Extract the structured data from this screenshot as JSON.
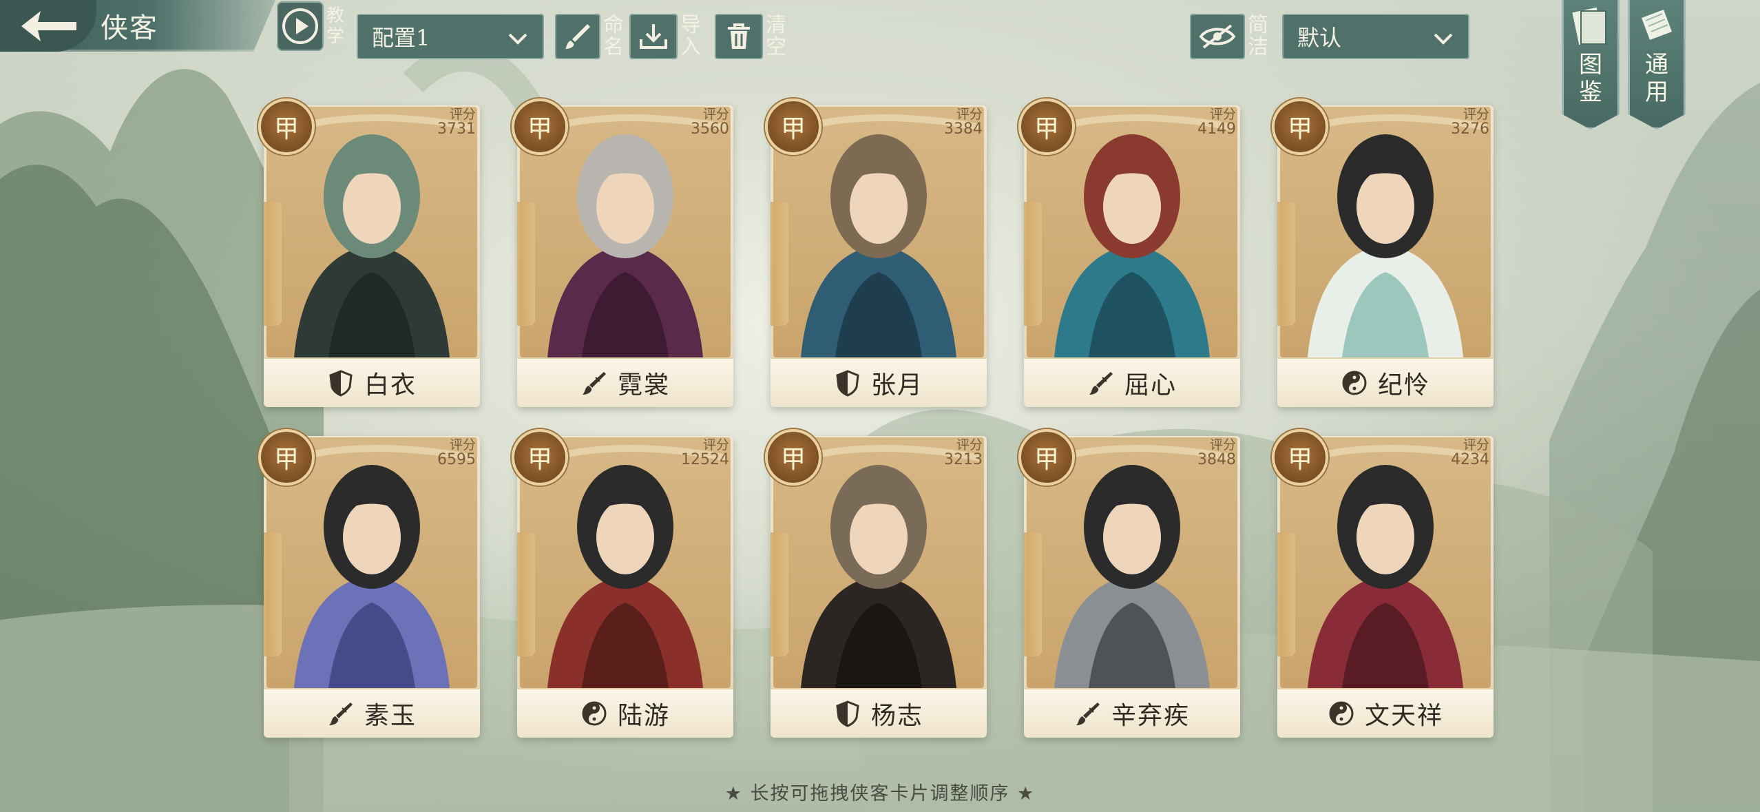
{
  "header": {
    "title": "侠客",
    "tutorial_label": "教学",
    "config_select": {
      "value": "配置1"
    },
    "rename_label": "命名",
    "import_label": "导入",
    "clear_label": "清空",
    "simple_label": "简洁",
    "sort_select": {
      "value": "默认"
    }
  },
  "side_tabs": {
    "collection_label": "图鉴",
    "general_label": "通用"
  },
  "score_label": "评分",
  "cards": [
    {
      "rank": "甲",
      "score": "3731",
      "name": "白衣",
      "class_icon": "shield-icon"
    },
    {
      "rank": "甲",
      "score": "3560",
      "name": "霓裳",
      "class_icon": "brush-icon"
    },
    {
      "rank": "甲",
      "score": "3384",
      "name": "张月",
      "class_icon": "shield-icon"
    },
    {
      "rank": "甲",
      "score": "4149",
      "name": "屈心",
      "class_icon": "brush-icon"
    },
    {
      "rank": "甲",
      "score": "3276",
      "name": "纪怜",
      "class_icon": "yinyang-icon"
    },
    {
      "rank": "甲",
      "score": "6595",
      "name": "素玉",
      "class_icon": "brush-icon"
    },
    {
      "rank": "甲",
      "score": "12524",
      "name": "陆游",
      "class_icon": "yinyang-icon"
    },
    {
      "rank": "甲",
      "score": "3213",
      "name": "杨志",
      "class_icon": "shield-icon"
    },
    {
      "rank": "甲",
      "score": "3848",
      "name": "辛弃疾",
      "class_icon": "brush-icon"
    },
    {
      "rank": "甲",
      "score": "4234",
      "name": "文天祥",
      "class_icon": "yinyang-icon"
    }
  ],
  "footer_hint": "★ 长按可拖拽侠客卡片调整顺序 ★",
  "colors": {
    "panel": "#4f7169",
    "card_frame": "#e5d6b5",
    "rank_badge": "#7c4f22"
  }
}
